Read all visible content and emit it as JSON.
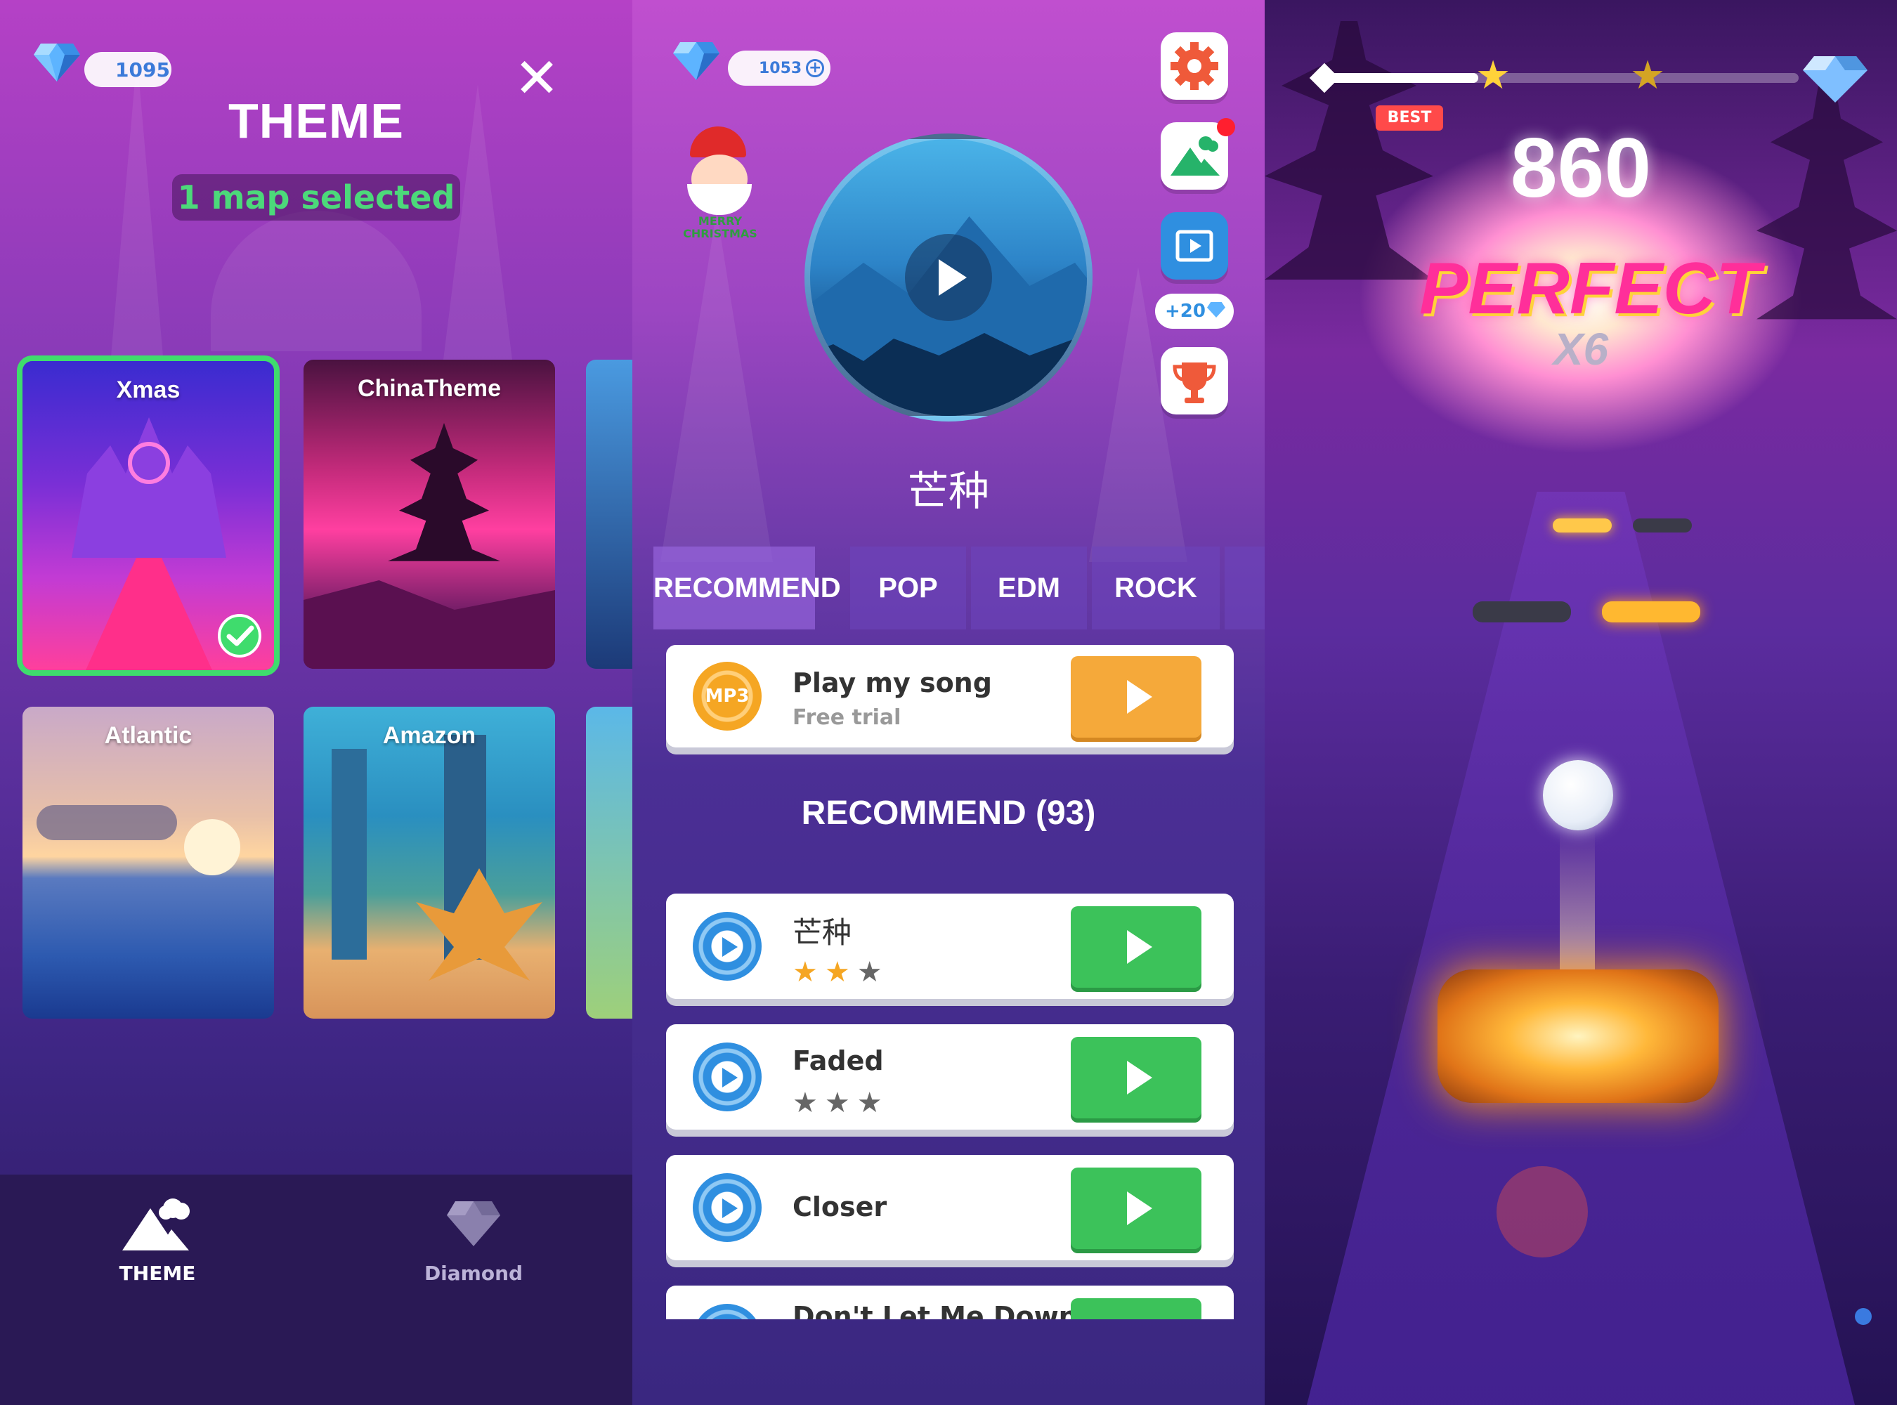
{
  "theme_screen": {
    "diamonds": "1095",
    "title": "THEME",
    "close_glyph": "✕",
    "selected_text": "1 map selected",
    "maps": [
      {
        "name": "Xmas",
        "selected": true
      },
      {
        "name": "ChinaTheme",
        "selected": false
      },
      {
        "name": "Atlantic",
        "selected": false
      },
      {
        "name": "Amazon",
        "selected": false
      }
    ],
    "tabs": [
      {
        "label": "THEME",
        "icon": "mountain-icon",
        "active": true
      },
      {
        "label": "Diamond",
        "icon": "diamond-icon",
        "active": false
      }
    ]
  },
  "song_screen": {
    "diamonds": "1053",
    "badge_text": "MERRY CHRISTMAS",
    "current_song": "芒种",
    "side_buttons": [
      {
        "icon": "settings-gear-icon"
      },
      {
        "icon": "theme-mountain-icon"
      },
      {
        "icon": "video-icon"
      },
      {
        "icon": "trophy-icon"
      }
    ],
    "video_reward": "+20",
    "genres": [
      "RECOMMEND",
      "POP",
      "EDM",
      "ROCK"
    ],
    "my_song": {
      "badge": "MP3",
      "title": "Play my song",
      "subtitle": "Free trial"
    },
    "list_heading": "RECOMMEND (93)",
    "songs": [
      {
        "name": "芒种",
        "stars_earned": 2,
        "stars_total": 3
      },
      {
        "name": "Faded",
        "stars_earned": 0,
        "stars_total": 3
      },
      {
        "name": "Closer"
      },
      {
        "name": "Don't Let Me Down"
      }
    ]
  },
  "gameplay_screen": {
    "best_label": "BEST",
    "score": "860",
    "judgement": "PERFECT",
    "combo": "X6",
    "progress_fraction": 0.33,
    "stars_reached": 1,
    "stars_total": 2
  },
  "colors": {
    "selection_green": "#3fdc6d",
    "play_green": "#3cc25a",
    "mp3_orange": "#f5a623",
    "accent_pink": "#ff3fa4"
  }
}
